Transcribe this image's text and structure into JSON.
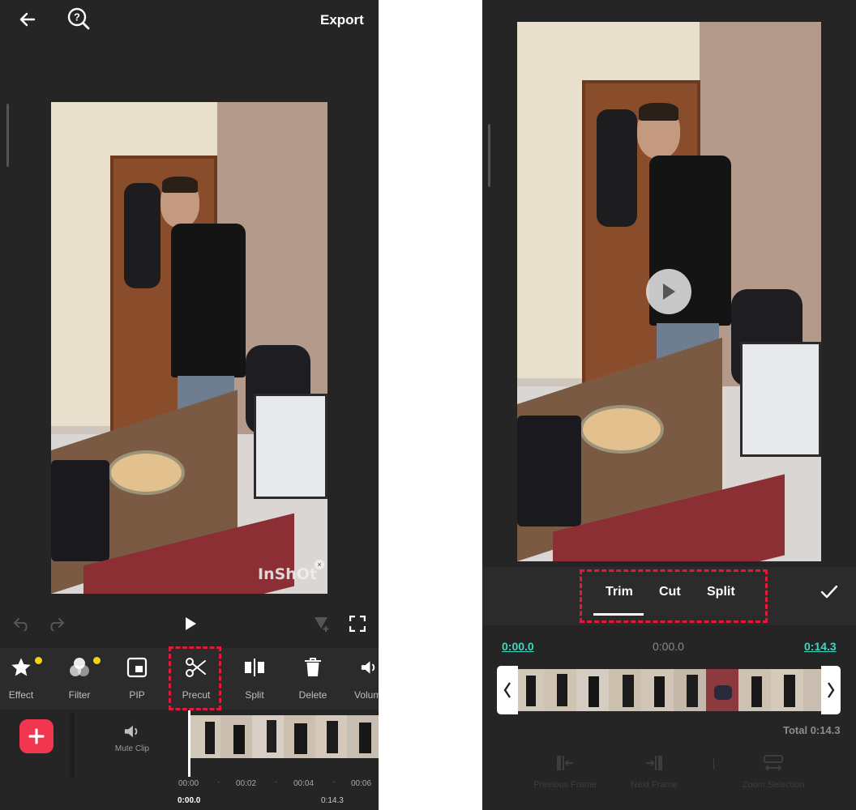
{
  "left": {
    "header": {
      "export_label": "Export"
    },
    "watermark": "InShOt",
    "toolbar": [
      {
        "id": "effect",
        "label": "Effect",
        "icon": "star-icon",
        "dot": true
      },
      {
        "id": "filter",
        "label": "Filter",
        "icon": "filter-icon",
        "dot": true
      },
      {
        "id": "pip",
        "label": "PIP",
        "icon": "pip-icon",
        "dot": false
      },
      {
        "id": "precut",
        "label": "Precut",
        "icon": "scissors-icon",
        "dot": false
      },
      {
        "id": "split",
        "label": "Split",
        "icon": "split-icon",
        "dot": false
      },
      {
        "id": "delete",
        "label": "Delete",
        "icon": "trash-icon",
        "dot": false
      },
      {
        "id": "volume",
        "label": "Volum",
        "icon": "volume-icon",
        "dot": false
      }
    ],
    "timeline": {
      "mute_clip_label": "Mute Clip",
      "ruler": [
        "00:00",
        "00:02",
        "00:04",
        "00:06"
      ],
      "current_time": "0:00.0",
      "total_time": "0:14.3"
    }
  },
  "right": {
    "tabs": [
      {
        "label": "Trim",
        "active": true
      },
      {
        "label": "Cut",
        "active": false
      },
      {
        "label": "Split",
        "active": false
      }
    ],
    "trim": {
      "start_time": "0:00.0",
      "current_time": "0:00.0",
      "end_time": "0:14.3",
      "total_label": "Total 0:14.3"
    },
    "bottom_controls": [
      {
        "label": "Previous Frame",
        "icon": "previous-frame-icon"
      },
      {
        "label": "Next Frame",
        "icon": "next-frame-icon"
      },
      {
        "label": "Zoom Selection",
        "icon": "zoom-selection-icon"
      }
    ]
  },
  "colors": {
    "background": "#252525",
    "accent_teal": "#3fd6bf",
    "highlight_red": "#e01a3c",
    "add_button": "#f0374f",
    "badge_yellow": "#f5d20f"
  }
}
